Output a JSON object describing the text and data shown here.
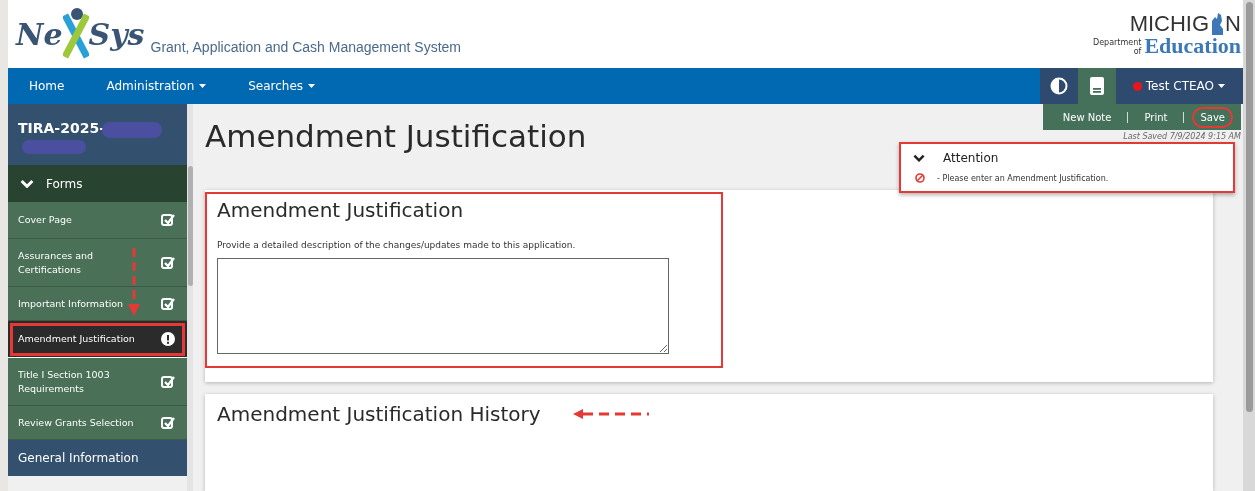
{
  "header": {
    "logo_left": "Ne",
    "logo_right": "Sys",
    "subtitle": "Grant, Application and Cash Management System",
    "agency": {
      "left": "MICHIG",
      "right": "N",
      "dept": "Department",
      "of": "of",
      "name": "Education"
    }
  },
  "nav": {
    "items": [
      {
        "label": "Home",
        "dropdown": false
      },
      {
        "label": "Administration",
        "dropdown": true
      },
      {
        "label": "Searches",
        "dropdown": true
      }
    ],
    "user": {
      "label": "Test CTEAO",
      "dropdown": true
    }
  },
  "sidebar": {
    "app_id": "TIRA-2025-",
    "section": {
      "label": "Forms",
      "expanded": true
    },
    "items": [
      {
        "label": "Cover Page",
        "kind": "complete",
        "selected": false
      },
      {
        "label": "Assurances and Certifications",
        "kind": "complete",
        "selected": false
      },
      {
        "label": "Important Information",
        "kind": "complete",
        "selected": false
      },
      {
        "label": "Amendment Justification",
        "kind": "error",
        "selected": true
      },
      {
        "label": "Title I Section 1003 Requirements",
        "kind": "complete",
        "selected": false
      },
      {
        "label": "Review Grants Selection",
        "kind": "complete",
        "selected": false
      }
    ],
    "next_section": "General Information"
  },
  "toolbar": {
    "actions": [
      "New Note",
      "Print",
      "Save"
    ],
    "last_saved": "Last Saved 7/9/2024 9:15 AM"
  },
  "page_title": "Amendment Justification",
  "attention": {
    "title": "Attention",
    "expanded": true,
    "messages": [
      "- Please enter an Amendment Justification."
    ]
  },
  "card": {
    "title": "Amendment Justification",
    "prompt": "Provide a detailed description of the changes/updates made to this application."
  },
  "history": {
    "title": "Amendment Justification History"
  }
}
